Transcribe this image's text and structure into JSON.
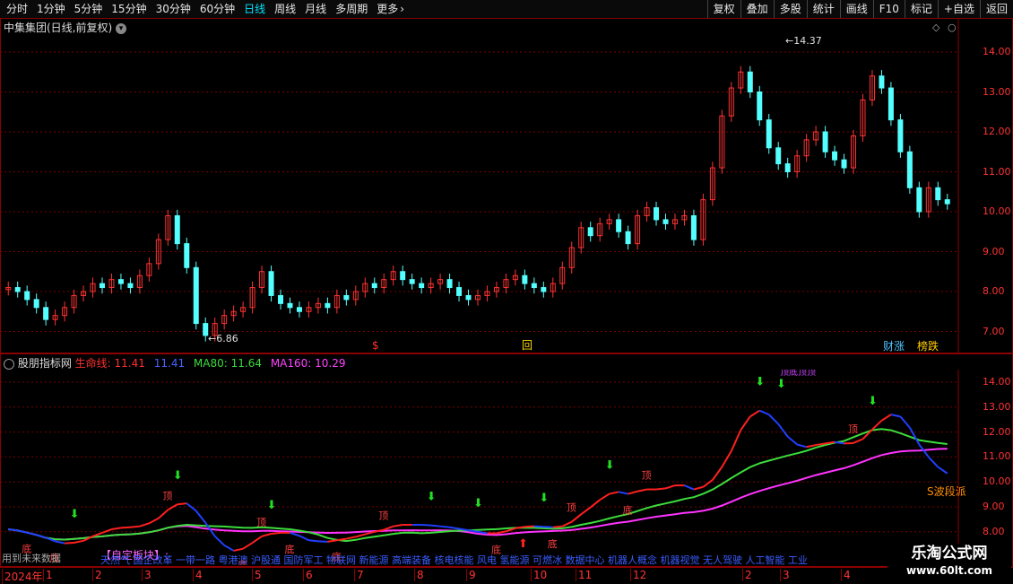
{
  "toolbar": {
    "periods": [
      "分时",
      "1分钟",
      "5分钟",
      "15分钟",
      "30分钟",
      "60分钟",
      "日线",
      "周线",
      "月线",
      "多周期",
      "更多"
    ],
    "active_period": "日线",
    "more_chevron": "›",
    "right_buttons": [
      "复权",
      "叠加",
      "多股",
      "统计",
      "画线",
      "F10",
      "标记",
      "+自选",
      "返回"
    ]
  },
  "main_panel": {
    "title": "中集集团(日线,前复权)",
    "dropdown_icon": "chevron-down-icon",
    "high_label": "14.37",
    "low_label": "6.86",
    "y_ticks": [
      "14.00",
      "13.00",
      "12.00",
      "11.00",
      "10.00",
      "9.00",
      "8.00",
      "7.00"
    ],
    "markers": {
      "s_mark": "$",
      "box_mark": "回",
      "badge_1": "财涨",
      "badge_2": "榜跌"
    }
  },
  "indicator_panel": {
    "title": "股朋指标网",
    "life_line_label": "生命线:",
    "life_line_value": "11.41",
    "blue_value": "11.41",
    "ma80_label": "MA80:",
    "ma80_value": "11.64",
    "ma160_label": "MA160:",
    "ma160_value": "10.29",
    "y_ticks": [
      "14.00",
      "13.00",
      "12.00",
      "11.00",
      "10.00",
      "9.00",
      "8.00"
    ],
    "footer_left": "用到未来数据",
    "custom_block": "【自定板块】:",
    "concepts": "天然气 国企改革 一带一路 粤港澳 沪股通 国防军工 物联网 新能源 高端装备 核电核能 风电 氢能源 可燃冰 数据中心 机器人概念 机器视觉 无人驾驶 人工智能 工业",
    "side_label": "S波段派",
    "top_markers": "顶底顶顶",
    "tag_top": "顶",
    "tag_bottom": "底"
  },
  "x_axis": {
    "labels": [
      "2024年",
      "1",
      "2",
      "3",
      "4",
      "5",
      "6",
      "7",
      "8",
      "9",
      "10",
      "11",
      "12",
      "2",
      "3",
      "4"
    ]
  },
  "watermark": {
    "title": "乐淘公式网",
    "url": "www.60lt.com"
  },
  "colors": {
    "up": "#ff3232",
    "down": "#54ffff",
    "grid": "#8b0000",
    "life": "#ff2020",
    "blue": "#2040ff",
    "ma80": "#3cdc3c",
    "ma160": "#ff33ff"
  },
  "chart_data": {
    "type": "line",
    "price_range": [
      6.86,
      14.37
    ],
    "close_series": [
      8.1,
      8.0,
      7.8,
      7.6,
      7.3,
      7.4,
      7.6,
      7.9,
      8.0,
      8.2,
      8.1,
      8.3,
      8.2,
      8.1,
      8.4,
      8.7,
      9.3,
      9.9,
      9.2,
      8.6,
      7.2,
      6.9,
      7.2,
      7.4,
      7.5,
      7.6,
      8.1,
      8.5,
      7.9,
      7.7,
      7.6,
      7.5,
      7.6,
      7.7,
      7.6,
      7.9,
      7.8,
      8.0,
      8.2,
      8.1,
      8.3,
      8.5,
      8.3,
      8.2,
      8.1,
      8.2,
      8.3,
      8.1,
      7.9,
      7.8,
      7.9,
      8.0,
      8.1,
      8.3,
      8.4,
      8.2,
      8.1,
      8.0,
      8.2,
      8.6,
      9.1,
      9.6,
      9.4,
      9.7,
      9.8,
      9.5,
      9.2,
      9.9,
      10.1,
      9.8,
      9.7,
      9.8,
      9.9,
      9.3,
      10.3,
      11.1,
      12.4,
      13.1,
      13.5,
      13.0,
      12.3,
      11.6,
      11.2,
      11.0,
      11.4,
      11.8,
      12.0,
      11.5,
      11.3,
      11.1,
      11.9,
      12.8,
      13.4,
      13.1,
      12.3,
      11.5,
      10.6,
      10.0,
      10.6,
      10.3,
      10.2
    ]
  }
}
